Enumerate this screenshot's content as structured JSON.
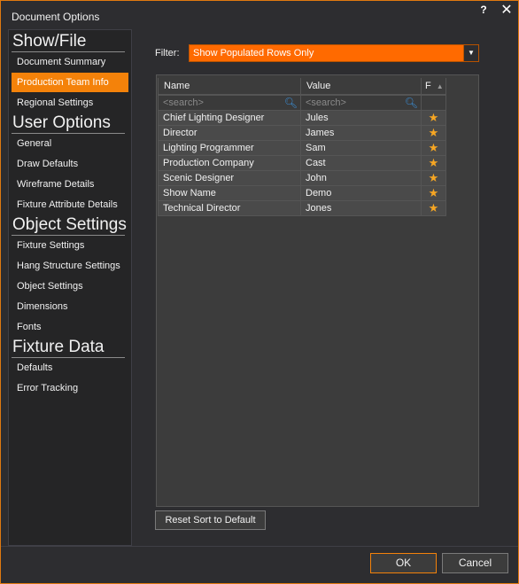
{
  "window": {
    "title": "Document Options",
    "help_label": "?",
    "close_label": "✕"
  },
  "sidebar": {
    "sections": [
      {
        "header": "Show/File",
        "items": [
          "Document Summary",
          "Production Team Info",
          "Regional Settings"
        ]
      },
      {
        "header": "User Options",
        "items": [
          "General",
          "Draw Defaults",
          "Wireframe Details",
          "Fixture Attribute Details"
        ]
      },
      {
        "header": "Object Settings",
        "items": [
          "Fixture Settings",
          "Hang Structure Settings",
          "Object Settings",
          "Dimensions",
          "Fonts"
        ]
      },
      {
        "header": "Fixture Data",
        "items": [
          "Defaults",
          "Error Tracking"
        ]
      }
    ],
    "active_item": "Production Team Info"
  },
  "filter": {
    "label": "Filter:",
    "value": "Show Populated Rows Only",
    "arrow": "▼"
  },
  "grid": {
    "columns": [
      "Name",
      "Value",
      "F"
    ],
    "sort_indicator": "▲",
    "search_placeholder": "<search>",
    "rows": [
      {
        "name": "Chief Lighting Designer",
        "value": "Jules",
        "favorite": true
      },
      {
        "name": "Director",
        "value": "James",
        "favorite": true
      },
      {
        "name": "Lighting Programmer",
        "value": "Sam",
        "favorite": true
      },
      {
        "name": "Production Company",
        "value": "Cast",
        "favorite": true
      },
      {
        "name": "Scenic Designer",
        "value": "John",
        "favorite": true
      },
      {
        "name": "Show Name",
        "value": "Demo",
        "favorite": true
      },
      {
        "name": "Technical Director",
        "value": "Jones",
        "favorite": true
      }
    ]
  },
  "buttons": {
    "reset": "Reset Sort to Default",
    "ok": "OK",
    "cancel": "Cancel"
  },
  "colors": {
    "accent": "#f4820a",
    "filter_bg": "#ff6a00",
    "star": "#f6a623",
    "background": "#2d2d30"
  }
}
